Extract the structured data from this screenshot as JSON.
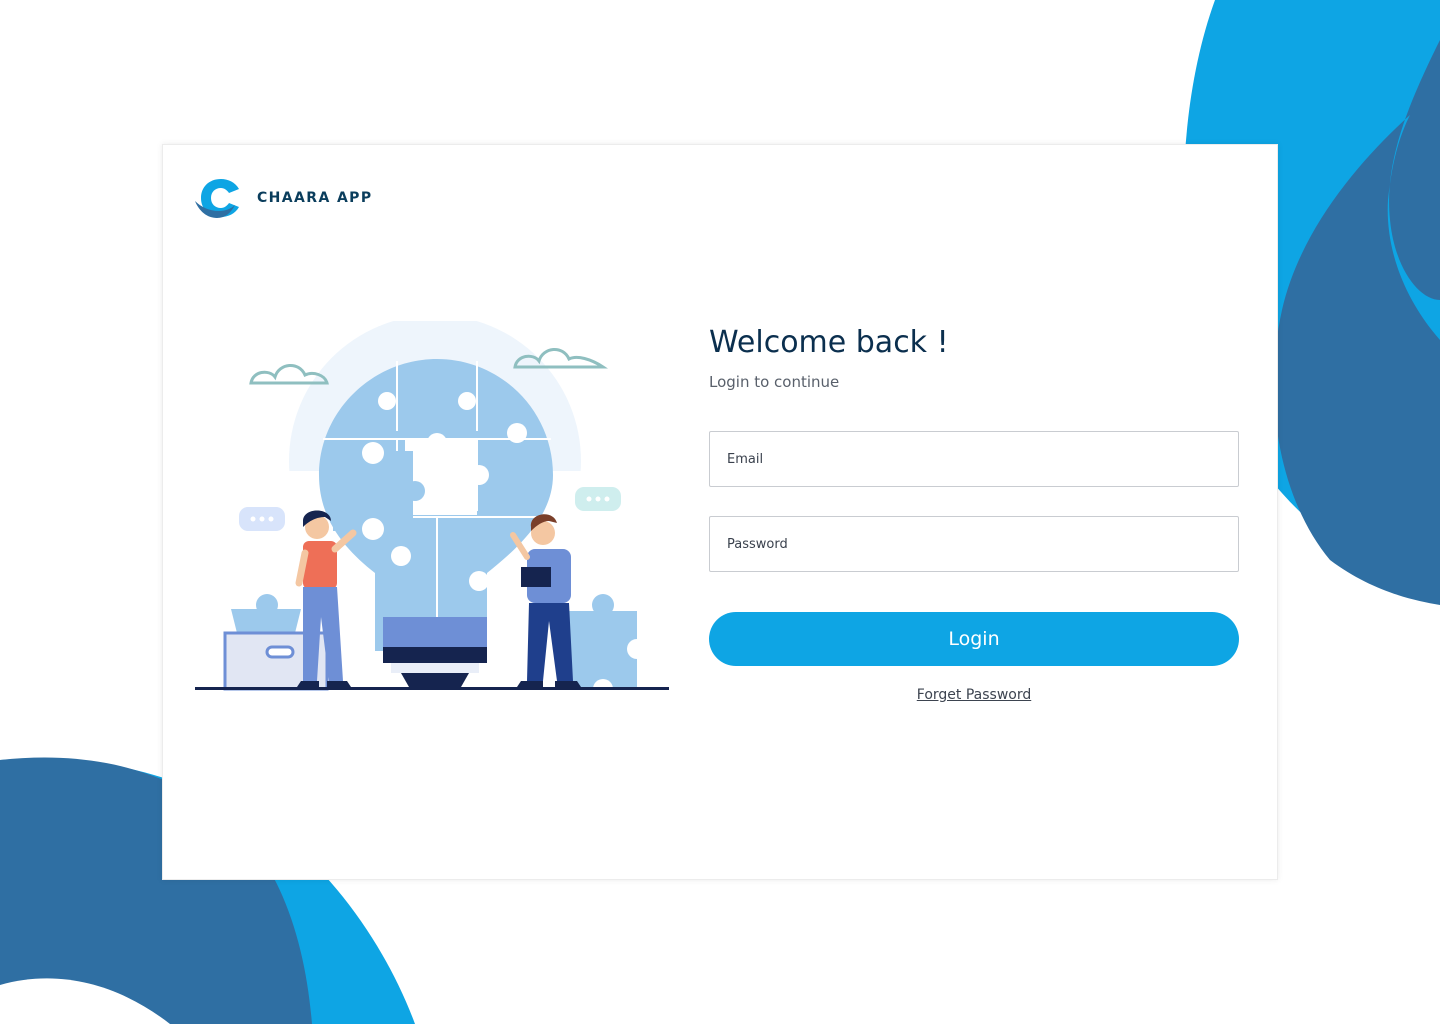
{
  "brand": {
    "name": "CHAARA APP",
    "logo_icon": "chaara-c-logo-icon"
  },
  "colors": {
    "primary": "#0EA5E4",
    "secondary": "#2F6FA3",
    "heading": "#0B2F4E",
    "illustration_light": "#9CC9EC",
    "illustration_dark": "#15244F"
  },
  "login": {
    "title": "Welcome back !",
    "subtitle": "Login to continue",
    "email_placeholder": "Email",
    "password_placeholder": "Password",
    "login_label": "Login",
    "forgot_label": "Forget Password"
  },
  "illustration": {
    "description_icon": "lightbulb-puzzle-illustration"
  }
}
